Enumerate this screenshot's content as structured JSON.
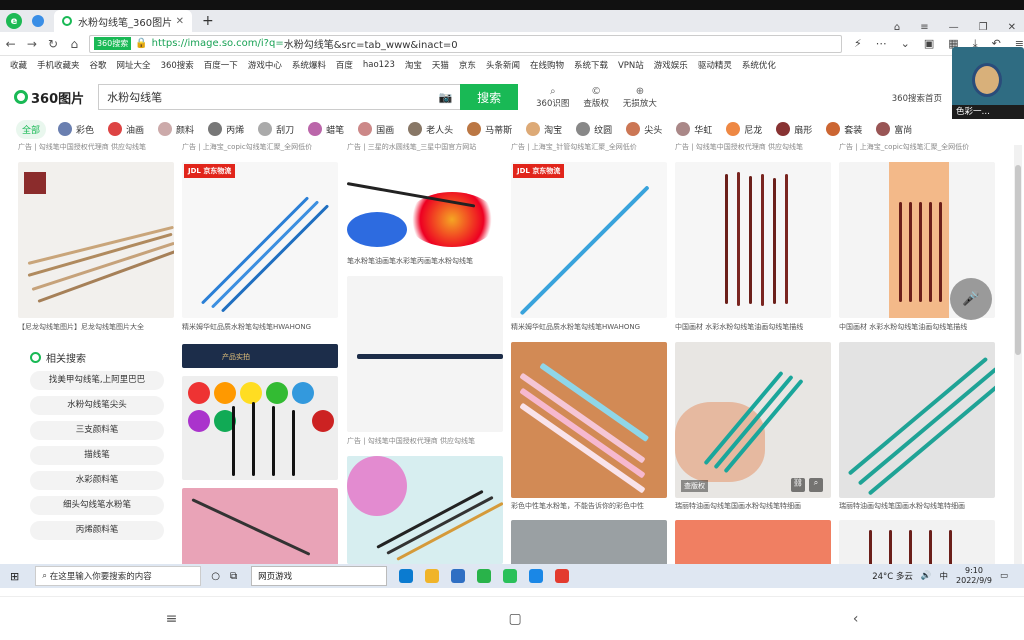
{
  "browser": {
    "tab_title": "水粉勾线笔_360图片",
    "url_prefix": "https://image.so.com/i?q=",
    "url_query": "水粉勾线笔&src=tab_www&inact=0",
    "shield_label": "360搜索"
  },
  "bookmarks": [
    "收藏",
    "手机收藏夹",
    "谷歌",
    "网址大全",
    "360搜索",
    "百度一下",
    "游戏中心",
    "系统爆料",
    "百度",
    "hao123",
    "淘宝",
    "天猫",
    "京东",
    "头条新闻",
    "在线购物",
    "系统下载",
    "VPN站",
    "游戏娱乐",
    "驱动精灵",
    "系统优化"
  ],
  "avatar_label": "色彩一…",
  "search": {
    "brand": "360图片",
    "query": "水粉勾线笔",
    "button": "搜索",
    "tool1": "360识图",
    "tool2": "查版权",
    "tool3": "无损放大",
    "home_link": "360搜索首页"
  },
  "categories": [
    "全部",
    "彩色",
    "油画",
    "颜料",
    "丙烯",
    "刮刀",
    "蜡笔",
    "国画",
    "老人头",
    "马蒂斯",
    "淘宝",
    "纹圆",
    "尖头",
    "华虹",
    "尼龙",
    "扇形",
    "套装",
    "富尚"
  ],
  "captions": {
    "top1": "广告 | 勾线笔中国授权代理商 供应勾线笔",
    "top2": "广告 | 上海宝_copic勾线笔汇聚_全网低价",
    "top3": "广告 | 三星的水圆线笔_三星中国官方网站",
    "top4": "广告 | 上海宝_针管勾线笔汇聚_全网低价",
    "top5": "广告 | 勾线笔中国授权代理商 供应勾线笔",
    "top6": "广告 | 上海宝_copic勾线笔汇聚_全网低价",
    "r1c1": "【尼龙勾线笔图片】尼龙勾线笔图片大全",
    "r1c2": "精米姆华虹品质水粉笔勾线笔HWAHONG",
    "r1c3": "笔水粉笔油画笔水彩笔丙画笔水粉勾线笔",
    "r1c4": "精米姆华虹品质水粉笔勾线笔HWAHONG",
    "r1c5": "中国画材 水彩水粉勾线笔油画勾线笔描线",
    "r1c6": "中国画材 水彩水粉勾线笔油画勾线笔描线",
    "c3b": "广告 | 勾线笔中国授权代理商 供应勾线笔",
    "r2c4": "彩色中性笔水粉笔，不能告诉你的彩色中性",
    "r2c5": "瑞丽特油画勾线笔国画水粉勾线笔特细画",
    "r2c6": "瑞丽特油画勾线笔国画水粉勾线笔特细画",
    "jd": "JDL 京东物流",
    "product_tag": "产品实拍",
    "copyright": "查版权"
  },
  "related": {
    "title": "相关搜索",
    "items": [
      "找美甲勾线笔,上阿里巴巴",
      "水粉勾线笔尖头",
      "三支颜料笔",
      "描线笔",
      "水彩颜料笔",
      "细头勾线笔水粉笔",
      "丙烯颜料笔"
    ],
    "ad": "广告"
  },
  "taskbar": {
    "search_placeholder": "在这里输入你要搜索的内容",
    "web_game": "网页游戏",
    "weather": "24°C 多云",
    "ime": "中",
    "time": "9:10",
    "date": "2022/9/9"
  },
  "colors": {
    "accent": "#19b955"
  }
}
